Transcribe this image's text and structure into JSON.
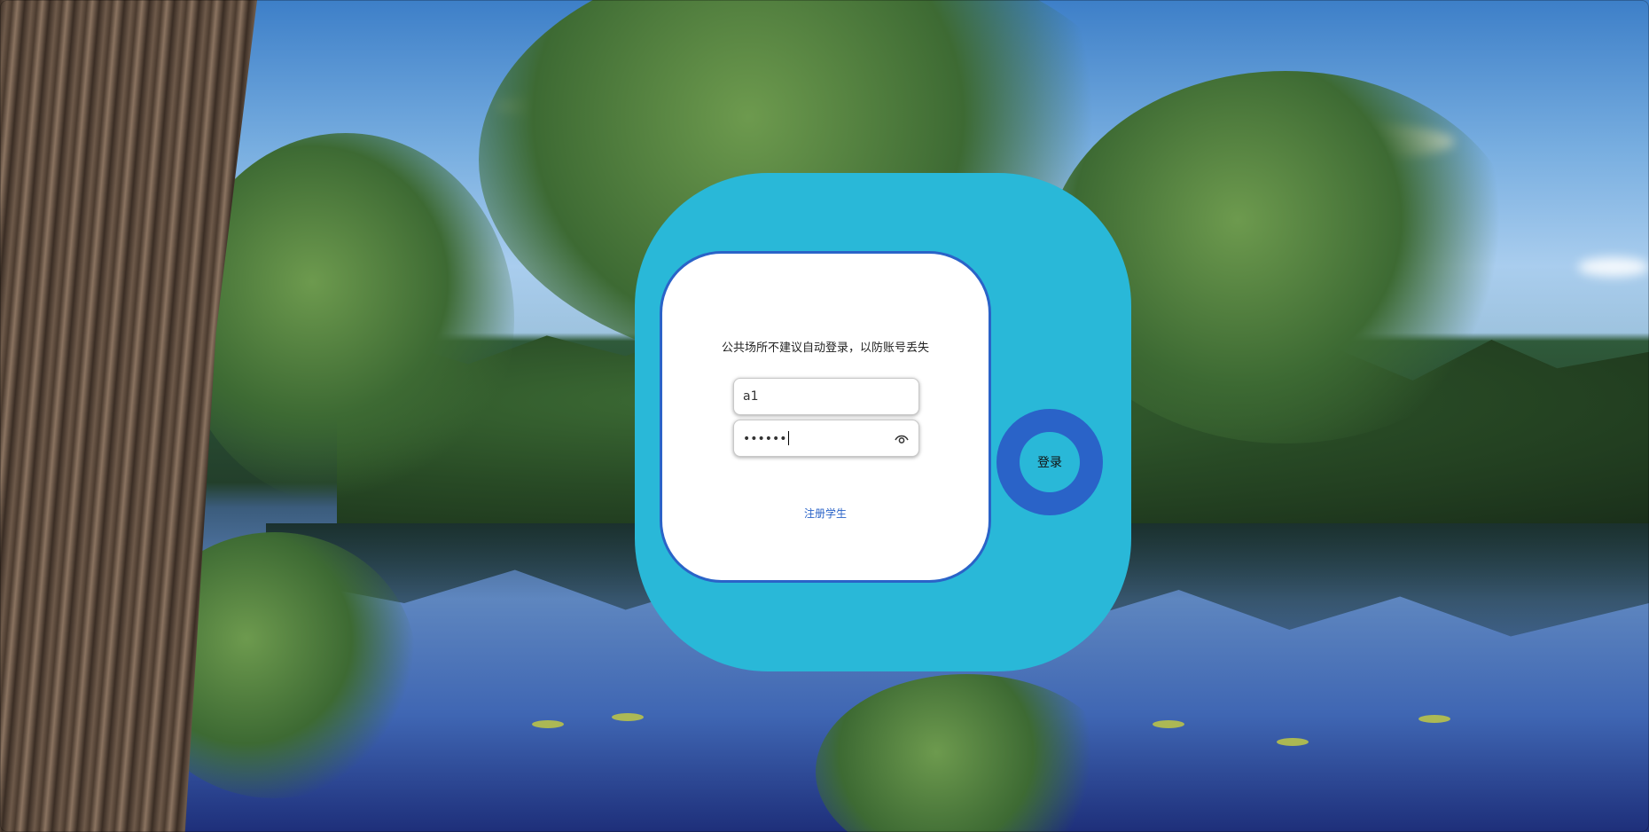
{
  "login": {
    "notice": "公共场所不建议自动登录，以防账号丢失",
    "username_value": "a1",
    "password_value": "••••••",
    "register_link": "注册学生",
    "login_button": "登录"
  },
  "icons": {
    "password_toggle": "eye-icon"
  },
  "colors": {
    "outer_panel": "#29b8d8",
    "card_border": "#2a63c8",
    "login_ring": "#2a63c8",
    "link": "#2a63c8"
  }
}
